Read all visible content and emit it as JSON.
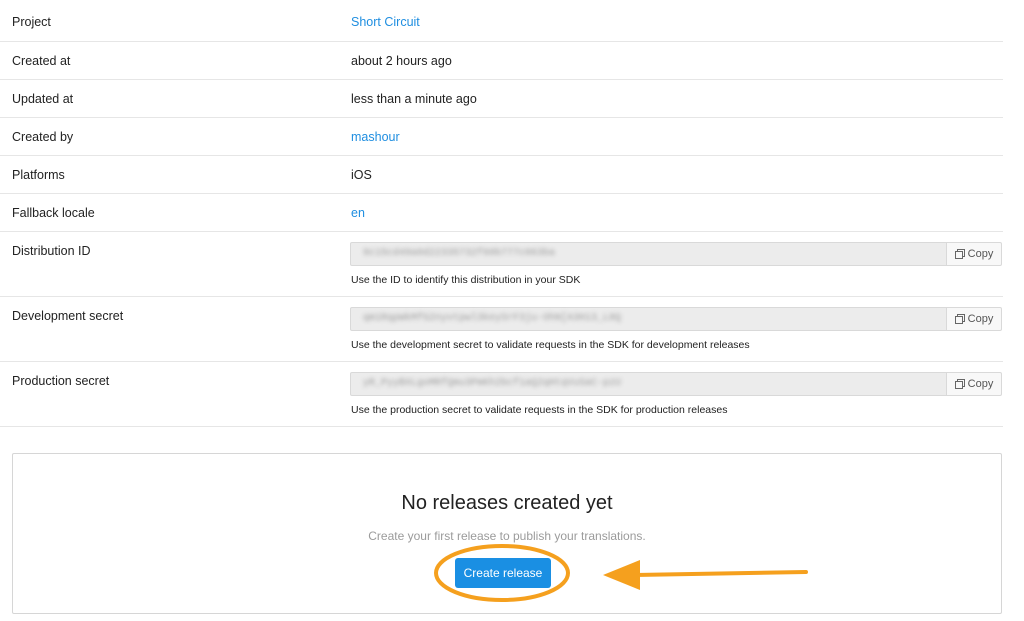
{
  "details": [
    {
      "label": "Project",
      "value": "Short Circuit",
      "link": true
    },
    {
      "label": "Created at",
      "value": "about 2 hours ago",
      "link": false
    },
    {
      "label": "Updated at",
      "value": "less than a minute ago",
      "link": false
    },
    {
      "label": "Created by",
      "value": "mashour",
      "link": true
    },
    {
      "label": "Platforms",
      "value": "iOS",
      "link": false
    },
    {
      "label": "Fallback locale",
      "value": "en",
      "link": true
    }
  ],
  "secrets": [
    {
      "label": "Distribution ID",
      "value": "9c15cd49a0d22335732f60b777c063ba",
      "hint": "Use the ID to identify this distribution in your SDK",
      "copy_label": "Copy"
    },
    {
      "label": "Development secret",
      "value": "qm1RqpWkMfG2nyvtpwl3keySrF3ju-OhN[A3H13_L8Q",
      "hint": "Use the development secret to validate requests in the SDK for development releases",
      "copy_label": "Copy"
    },
    {
      "label": "Production secret",
      "value": "yR_PyyBXLgoMRfQmu3PmKh2bcf1aQ2qHtqVuSaC-pzU",
      "hint": "Use the production secret to validate requests in the SDK for production releases",
      "copy_label": "Copy"
    }
  ],
  "empty_state": {
    "title": "No releases created yet",
    "subtitle": "Create your first release to publish your translations.",
    "button_label": "Create release"
  },
  "colors": {
    "link": "#1f8ee0",
    "primary_button": "#1a8fe3",
    "annotation": "#f5a01e"
  }
}
